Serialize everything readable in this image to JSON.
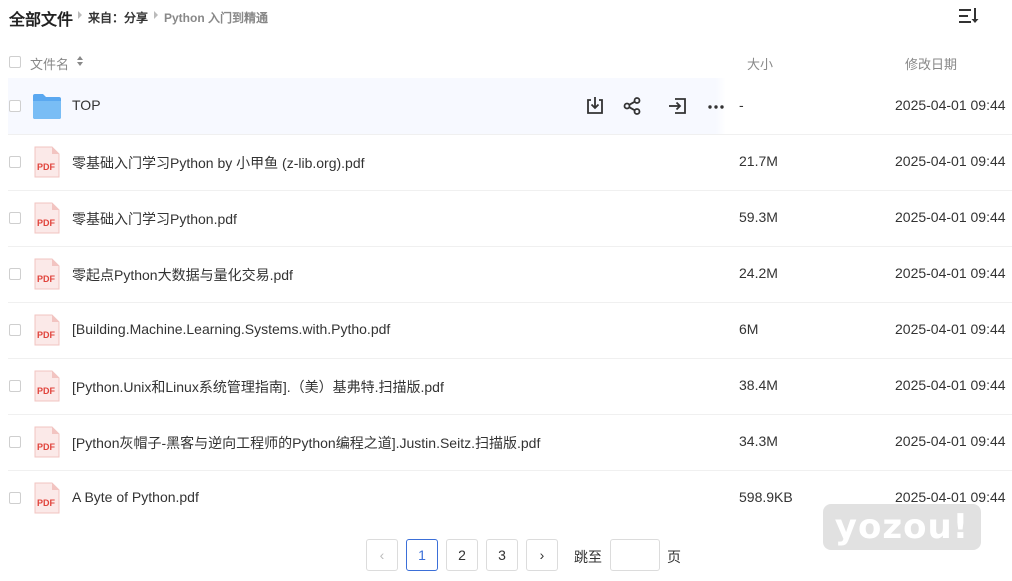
{
  "header": {
    "title": "全部文件",
    "breadcrumb_from": "来自：分享",
    "breadcrumb_current": "Python 入门到精通"
  },
  "columns": {
    "name": "文件名",
    "size": "大小",
    "date": "修改日期"
  },
  "files": [
    {
      "type": "folder",
      "name": "TOP",
      "size": "-",
      "date": "2025-04-01 09:44"
    },
    {
      "type": "pdf",
      "name": "零基础入门学习Python by 小甲鱼 (z-lib.org).pdf",
      "size": "21.7M",
      "date": "2025-04-01 09:44"
    },
    {
      "type": "pdf",
      "name": "零基础入门学习Python.pdf",
      "size": "59.3M",
      "date": "2025-04-01 09:44"
    },
    {
      "type": "pdf",
      "name": "零起点Python大数据与量化交易.pdf",
      "size": "24.2M",
      "date": "2025-04-01 09:44"
    },
    {
      "type": "pdf",
      "name": "[Building.Machine.Learning.Systems.with.Pytho.pdf",
      "size": "6M",
      "date": "2025-04-01 09:44"
    },
    {
      "type": "pdf",
      "name": "[Python.Unix和Linux系统管理指南].（美）基弗特.扫描版.pdf",
      "size": "38.4M",
      "date": "2025-04-01 09:44"
    },
    {
      "type": "pdf",
      "name": "[Python灰帽子-黑客与逆向工程师的Python编程之道].Justin.Seitz.扫描版.pdf",
      "size": "34.3M",
      "date": "2025-04-01 09:44"
    },
    {
      "type": "pdf",
      "name": "A Byte of Python.pdf",
      "size": "598.9KB",
      "date": "2025-04-01 09:44"
    }
  ],
  "pdf_badge": "PDF",
  "row_actions": [
    "download-icon",
    "share-icon",
    "save-to-icon",
    "more-icon"
  ],
  "pagination": {
    "prev": "‹",
    "pages": [
      "1",
      "2",
      "3"
    ],
    "current": "1",
    "next": "›",
    "jump_label": "跳至",
    "page_suffix": "页"
  },
  "watermark": "yozou!",
  "colors": {
    "accent": "#3b6fd8",
    "folder": "#5aa8f0",
    "pdf_red": "#e0433b",
    "hover_row": "#f7f9ff"
  }
}
